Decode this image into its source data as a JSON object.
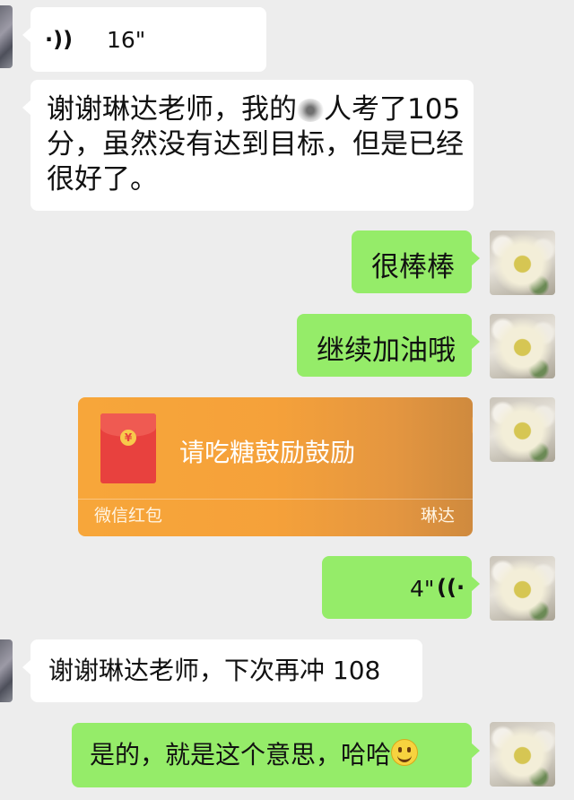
{
  "messages": [
    {
      "id": "m1",
      "side": "left",
      "type": "voice",
      "duration": "16\""
    },
    {
      "id": "m2",
      "side": "left",
      "type": "text",
      "line1_a": "谢谢琳达老师，我的",
      "line1_b": "人考了105",
      "line2": "分，虽然没有达到目标，但是已经",
      "line3": "很好了。"
    },
    {
      "id": "m3",
      "side": "right",
      "type": "text",
      "text": "很棒棒"
    },
    {
      "id": "m4",
      "side": "right",
      "type": "text",
      "text": "继续加油哦"
    },
    {
      "id": "m5",
      "side": "right",
      "type": "red_packet",
      "greeting": "请吃糖鼓励鼓励",
      "brand": "微信红包",
      "sender": "琳达"
    },
    {
      "id": "m6",
      "side": "right",
      "type": "voice",
      "duration": "4\""
    },
    {
      "id": "m7",
      "side": "left",
      "type": "text",
      "text": "谢谢琳达老师，下次再冲 108"
    },
    {
      "id": "m8",
      "side": "right",
      "type": "text",
      "text": "是的，就是这个意思，哈哈"
    }
  ],
  "icons": {
    "voice_left": "voice-wave-icon",
    "voice_right": "voice-wave-icon",
    "emoji": "smile-emoji-icon",
    "red_packet": "red-envelope-icon"
  },
  "colors": {
    "background": "#ededed",
    "bubble_self": "#95ec69",
    "bubble_other": "#ffffff",
    "red_packet": "#f5a13a"
  }
}
